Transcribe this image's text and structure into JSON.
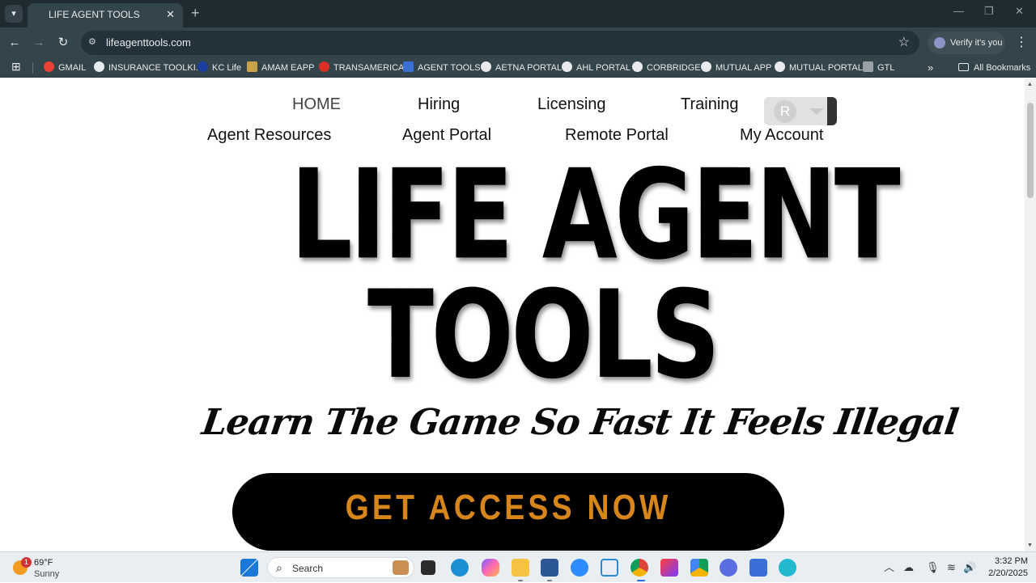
{
  "browser": {
    "tab_title": "LIFE AGENT TOOLS",
    "url": "lifeagenttools.com",
    "profile_label": "Verify it's you"
  },
  "bookmarks": [
    {
      "label": "GMAIL",
      "color": "#ea4335"
    },
    {
      "label": "INSURANCE TOOLKI...",
      "color": "#e8eaed"
    },
    {
      "label": "KC Life",
      "color": "#1a3fa0"
    },
    {
      "label": "AMAM EAPP",
      "color": "#c9a24a"
    },
    {
      "label": "TRANSAMERICA",
      "color": "#d93025"
    },
    {
      "label": "AGENT TOOLS",
      "color": "#3b6fd8"
    },
    {
      "label": "AETNA PORTAL",
      "color": "#e8eaed"
    },
    {
      "label": "AHL PORTAL",
      "color": "#e8eaed"
    },
    {
      "label": "CORBRIDGE",
      "color": "#e8eaed"
    },
    {
      "label": "MUTUAL APP",
      "color": "#e8eaed"
    },
    {
      "label": "MUTUAL PORTAL",
      "color": "#e8eaed"
    },
    {
      "label": "GTL",
      "color": "#9aa0a6"
    }
  ],
  "all_bookmarks_label": "All Bookmarks",
  "site": {
    "nav_row1": [
      "HOME",
      "Hiring",
      "Licensing",
      "Training"
    ],
    "nav_row2": [
      "Agent Resources",
      "Agent Portal",
      "Remote Portal",
      "My Account"
    ],
    "account_initial": "R",
    "logo_line1": "LIFE AGENT",
    "logo_line2": "TOOLS",
    "tagline": "Learn The Game So Fast It Feels Illegal",
    "cta_label": "GET ACCESS NOW",
    "accent_color": "#d6861a"
  },
  "taskbar": {
    "weather_temp": "69°F",
    "weather_condition": "Sunny",
    "weather_badge": "1",
    "search_label": "Search",
    "time": "3:32 PM",
    "date": "2/20/2025"
  }
}
